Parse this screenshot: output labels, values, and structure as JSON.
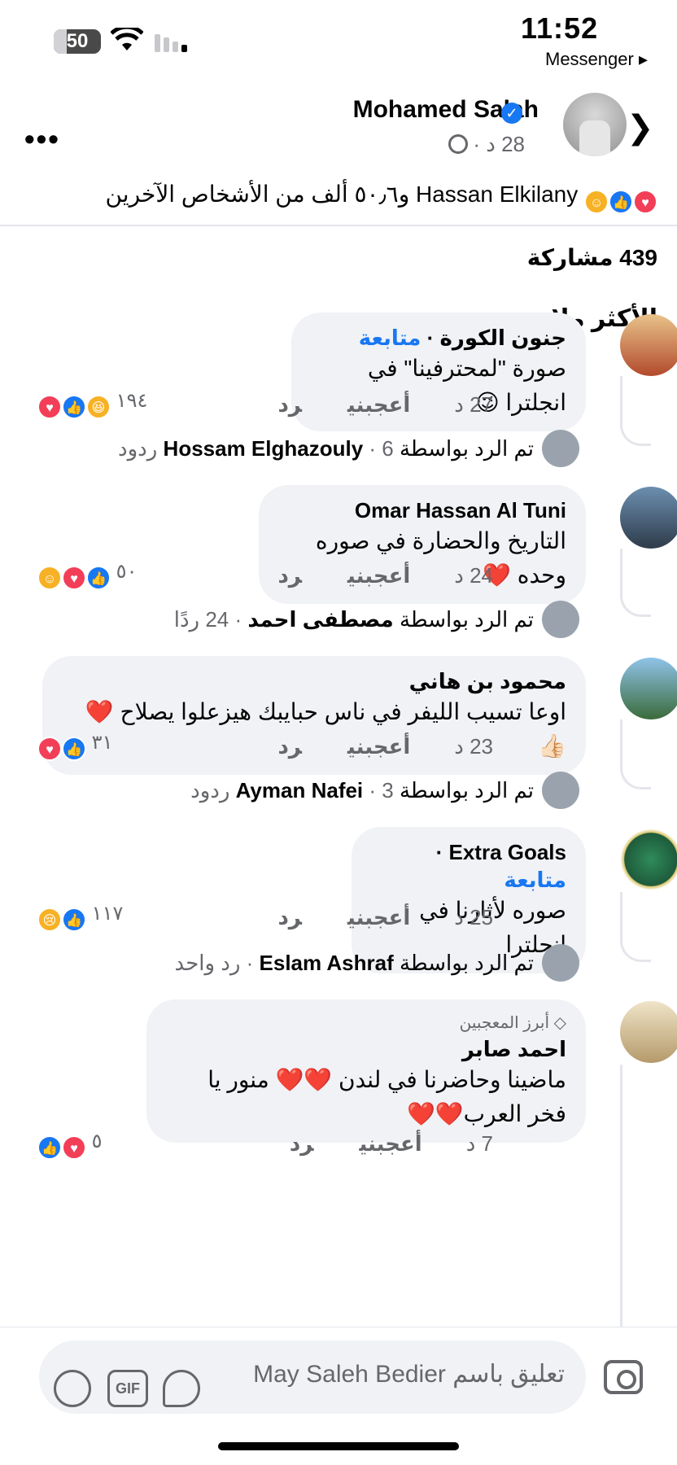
{
  "status": {
    "battery": "50",
    "time": "11:52",
    "back_app": "Messenger ▸"
  },
  "post": {
    "author": "Mohamed Salah",
    "meta": "28 د ·",
    "reactions_text": "Hassan Elkilany و٥٠٫٦ ألف من الأشخاص الآخرين",
    "shares": "439 مشاركة",
    "sort_label": "الأكثر ملاءمة ⌄"
  },
  "icons": {
    "more": "more-icon",
    "next": "chevron-right-icon",
    "verified": "verified-badge-icon",
    "globe": "globe-icon"
  },
  "colors": {
    "accent": "#1877f2",
    "heart": "#f33e58",
    "bubble": "#f0f2f5",
    "muted": "#65676b"
  },
  "comments": [
    {
      "name": "جنون الكورة",
      "follow": "متابعة",
      "text": "صورة \"لمحترفينا\" في انجلترا 😉",
      "time": "27 د",
      "like": "أعجبني",
      "reply": "رد",
      "count": "١٩٤",
      "replied_by": "Hossam Elghazouly",
      "replies": "· 6 ردود",
      "reply_prefix": "تم الرد بواسطة"
    },
    {
      "name": "Omar Hassan Al Tuni",
      "text": "التاريخ والحضارة في صوره وحده ❤️",
      "time": "24 د",
      "like": "أعجبني",
      "reply": "رد",
      "count": "٥٠",
      "replied_by": "مصطفى احمد",
      "replies": "· 24 ردًا",
      "reply_prefix": "تم الرد بواسطة"
    },
    {
      "name": "محمود بن هاني",
      "text": "اوعا تسيب الليفر في ناس حبايبك هيزعلوا يصلاح ❤️👍🏻",
      "time": "23 د",
      "like": "أعجبني",
      "reply": "رد",
      "count": "٣١",
      "replied_by": "Ayman Nafei",
      "replies": "· 3 ردود",
      "reply_prefix": "تم الرد بواسطة"
    },
    {
      "name": "Extra Goals",
      "follow": "متابعة",
      "text": "صوره لأثارنا في انجلترا",
      "time": "25 د",
      "like": "أعجبني",
      "reply": "رد",
      "count": "١١٧",
      "replied_by": "Eslam Ashraf",
      "replies": "· رد واحد",
      "reply_prefix": "تم الرد بواسطة"
    },
    {
      "badge": "أبرز المعجبين",
      "name": "احمد صابر",
      "text": "ماضينا وحاضرنا في لندن ❤️❤️ منور يا فخر العرب❤️❤️",
      "time": "7 د",
      "like": "أعجبني",
      "reply": "رد",
      "count": "٥"
    }
  ],
  "composer": {
    "placeholder": "تعليق باسم May Saleh Bedier",
    "gif": "GIF"
  }
}
